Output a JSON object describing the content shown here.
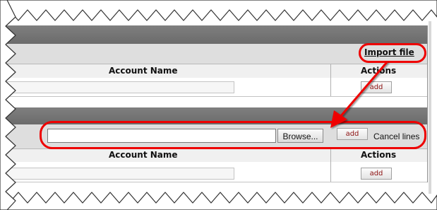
{
  "panel_top": {
    "import_link": "Import file",
    "columns": {
      "account_name": "Account Name",
      "actions": "Actions"
    },
    "row": {
      "add_label": "add"
    }
  },
  "panel_bottom": {
    "import_row": {
      "browse_label": "Browse...",
      "add_label": "add",
      "cancel_label": "Cancel lines"
    },
    "columns": {
      "account_name": "Account Name",
      "actions": "Actions"
    },
    "row": {
      "add_label": "add"
    }
  },
  "colors": {
    "annotation": "#ee0000",
    "add_text": "#8c1010",
    "header_dark": "#737373"
  }
}
